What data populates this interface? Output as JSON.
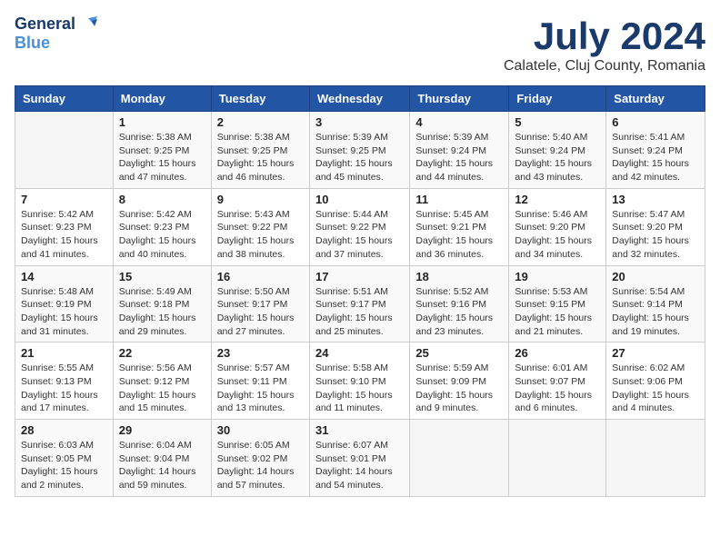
{
  "header": {
    "logo_line1": "General",
    "logo_line2": "Blue",
    "month_year": "July 2024",
    "location": "Calatele, Cluj County, Romania"
  },
  "columns": [
    "Sunday",
    "Monday",
    "Tuesday",
    "Wednesday",
    "Thursday",
    "Friday",
    "Saturday"
  ],
  "weeks": [
    [
      {
        "day": "",
        "content": ""
      },
      {
        "day": "1",
        "content": "Sunrise: 5:38 AM\nSunset: 9:25 PM\nDaylight: 15 hours\nand 47 minutes."
      },
      {
        "day": "2",
        "content": "Sunrise: 5:38 AM\nSunset: 9:25 PM\nDaylight: 15 hours\nand 46 minutes."
      },
      {
        "day": "3",
        "content": "Sunrise: 5:39 AM\nSunset: 9:25 PM\nDaylight: 15 hours\nand 45 minutes."
      },
      {
        "day": "4",
        "content": "Sunrise: 5:39 AM\nSunset: 9:24 PM\nDaylight: 15 hours\nand 44 minutes."
      },
      {
        "day": "5",
        "content": "Sunrise: 5:40 AM\nSunset: 9:24 PM\nDaylight: 15 hours\nand 43 minutes."
      },
      {
        "day": "6",
        "content": "Sunrise: 5:41 AM\nSunset: 9:24 PM\nDaylight: 15 hours\nand 42 minutes."
      }
    ],
    [
      {
        "day": "7",
        "content": "Sunrise: 5:42 AM\nSunset: 9:23 PM\nDaylight: 15 hours\nand 41 minutes."
      },
      {
        "day": "8",
        "content": "Sunrise: 5:42 AM\nSunset: 9:23 PM\nDaylight: 15 hours\nand 40 minutes."
      },
      {
        "day": "9",
        "content": "Sunrise: 5:43 AM\nSunset: 9:22 PM\nDaylight: 15 hours\nand 38 minutes."
      },
      {
        "day": "10",
        "content": "Sunrise: 5:44 AM\nSunset: 9:22 PM\nDaylight: 15 hours\nand 37 minutes."
      },
      {
        "day": "11",
        "content": "Sunrise: 5:45 AM\nSunset: 9:21 PM\nDaylight: 15 hours\nand 36 minutes."
      },
      {
        "day": "12",
        "content": "Sunrise: 5:46 AM\nSunset: 9:20 PM\nDaylight: 15 hours\nand 34 minutes."
      },
      {
        "day": "13",
        "content": "Sunrise: 5:47 AM\nSunset: 9:20 PM\nDaylight: 15 hours\nand 32 minutes."
      }
    ],
    [
      {
        "day": "14",
        "content": "Sunrise: 5:48 AM\nSunset: 9:19 PM\nDaylight: 15 hours\nand 31 minutes."
      },
      {
        "day": "15",
        "content": "Sunrise: 5:49 AM\nSunset: 9:18 PM\nDaylight: 15 hours\nand 29 minutes."
      },
      {
        "day": "16",
        "content": "Sunrise: 5:50 AM\nSunset: 9:17 PM\nDaylight: 15 hours\nand 27 minutes."
      },
      {
        "day": "17",
        "content": "Sunrise: 5:51 AM\nSunset: 9:17 PM\nDaylight: 15 hours\nand 25 minutes."
      },
      {
        "day": "18",
        "content": "Sunrise: 5:52 AM\nSunset: 9:16 PM\nDaylight: 15 hours\nand 23 minutes."
      },
      {
        "day": "19",
        "content": "Sunrise: 5:53 AM\nSunset: 9:15 PM\nDaylight: 15 hours\nand 21 minutes."
      },
      {
        "day": "20",
        "content": "Sunrise: 5:54 AM\nSunset: 9:14 PM\nDaylight: 15 hours\nand 19 minutes."
      }
    ],
    [
      {
        "day": "21",
        "content": "Sunrise: 5:55 AM\nSunset: 9:13 PM\nDaylight: 15 hours\nand 17 minutes."
      },
      {
        "day": "22",
        "content": "Sunrise: 5:56 AM\nSunset: 9:12 PM\nDaylight: 15 hours\nand 15 minutes."
      },
      {
        "day": "23",
        "content": "Sunrise: 5:57 AM\nSunset: 9:11 PM\nDaylight: 15 hours\nand 13 minutes."
      },
      {
        "day": "24",
        "content": "Sunrise: 5:58 AM\nSunset: 9:10 PM\nDaylight: 15 hours\nand 11 minutes."
      },
      {
        "day": "25",
        "content": "Sunrise: 5:59 AM\nSunset: 9:09 PM\nDaylight: 15 hours\nand 9 minutes."
      },
      {
        "day": "26",
        "content": "Sunrise: 6:01 AM\nSunset: 9:07 PM\nDaylight: 15 hours\nand 6 minutes."
      },
      {
        "day": "27",
        "content": "Sunrise: 6:02 AM\nSunset: 9:06 PM\nDaylight: 15 hours\nand 4 minutes."
      }
    ],
    [
      {
        "day": "28",
        "content": "Sunrise: 6:03 AM\nSunset: 9:05 PM\nDaylight: 15 hours\nand 2 minutes."
      },
      {
        "day": "29",
        "content": "Sunrise: 6:04 AM\nSunset: 9:04 PM\nDaylight: 14 hours\nand 59 minutes."
      },
      {
        "day": "30",
        "content": "Sunrise: 6:05 AM\nSunset: 9:02 PM\nDaylight: 14 hours\nand 57 minutes."
      },
      {
        "day": "31",
        "content": "Sunrise: 6:07 AM\nSunset: 9:01 PM\nDaylight: 14 hours\nand 54 minutes."
      },
      {
        "day": "",
        "content": ""
      },
      {
        "day": "",
        "content": ""
      },
      {
        "day": "",
        "content": ""
      }
    ]
  ]
}
